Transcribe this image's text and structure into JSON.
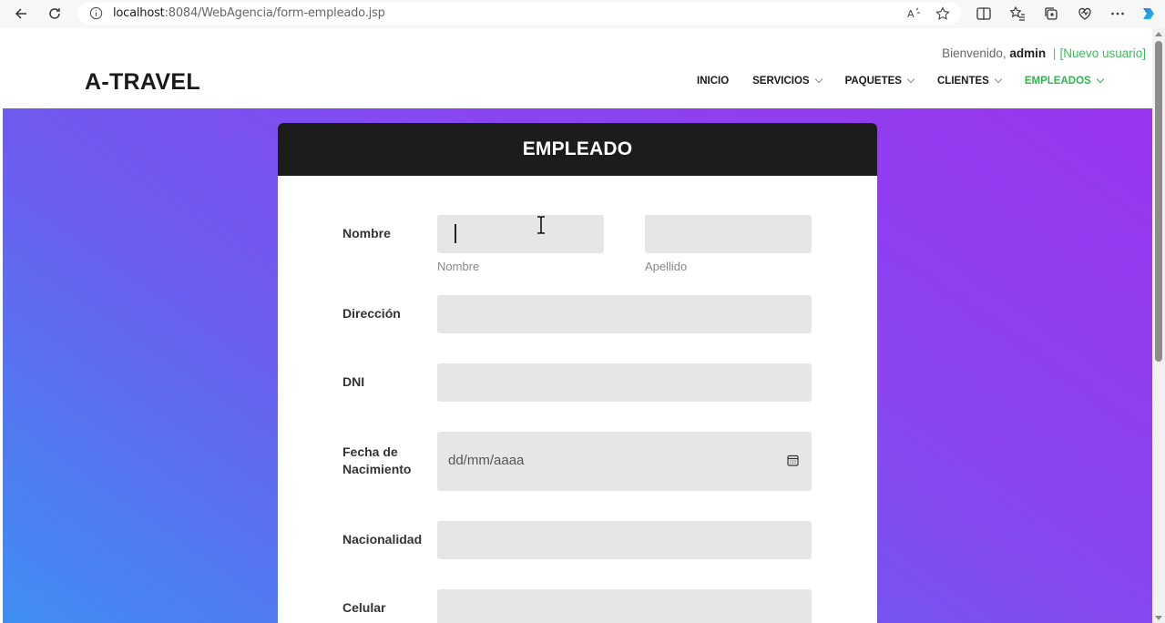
{
  "browser": {
    "url_host": "localhost",
    "url_path": ":8084/WebAgencia/form-empleado.jsp"
  },
  "header": {
    "welcome_prefix": "Bienvenido,",
    "username": "admin",
    "separator": "|",
    "new_user_link": "[Nuevo usuario]",
    "logo": "A-TRAVEL",
    "menu": [
      {
        "label": "INICIO",
        "dropdown": false
      },
      {
        "label": "SERVICIOS",
        "dropdown": true
      },
      {
        "label": "PAQUETES",
        "dropdown": true
      },
      {
        "label": "CLIENTES",
        "dropdown": true
      },
      {
        "label": "EMPLEADOS",
        "dropdown": true,
        "active": true
      }
    ],
    "active_color": "#2fb551"
  },
  "form": {
    "title": "EMPLEADO",
    "labels": {
      "nombre": "Nombre",
      "direccion": "Dirección",
      "dni": "DNI",
      "fecha_line1": "Fecha de",
      "fecha_line2": "Nacimiento",
      "nacionalidad": "Nacionalidad",
      "celular": "Celular"
    },
    "hints": {
      "nombre": "Nombre",
      "apellido": "Apellido"
    },
    "values": {
      "nombre": "",
      "apellido": "",
      "direccion": "",
      "dni": "",
      "nacionalidad": "",
      "celular": ""
    },
    "date_placeholder": "dd/mm/aaaa"
  }
}
